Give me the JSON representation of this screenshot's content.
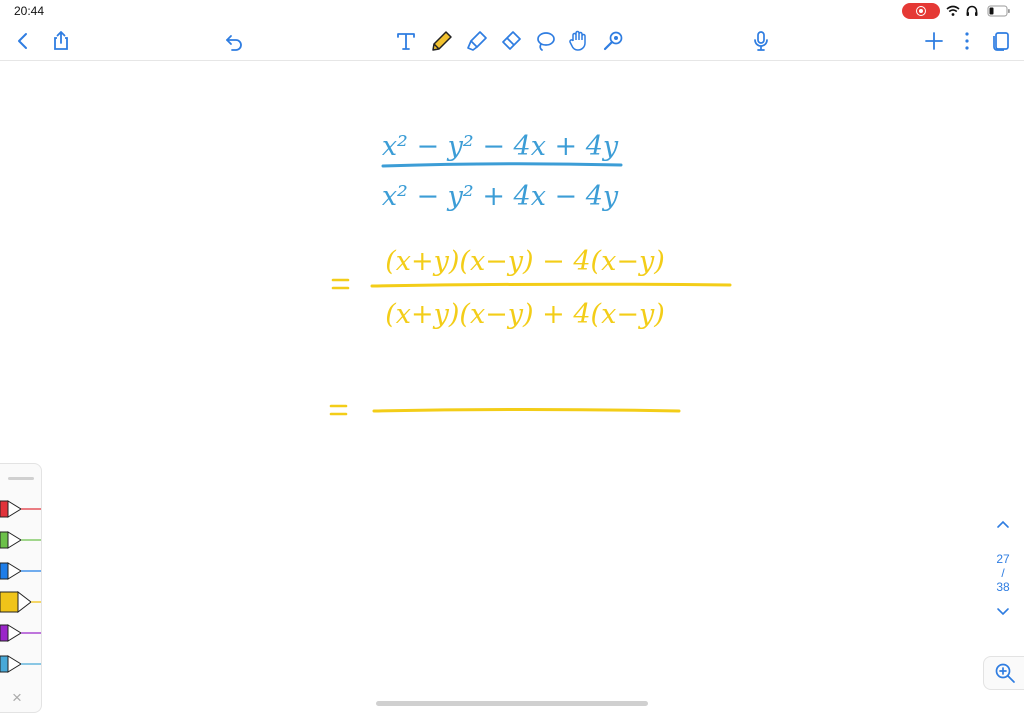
{
  "status": {
    "time": "20:44",
    "icons": [
      "screen-record-icon",
      "wifi-icon",
      "headphones-icon",
      "battery-icon"
    ]
  },
  "toolbar": {
    "left": [
      "back-icon",
      "share-icon",
      "undo-icon"
    ],
    "tools": [
      "text-tool-icon",
      "pen-tool-icon",
      "highlighter-tool-icon",
      "eraser-tool-icon",
      "lasso-tool-icon",
      "hand-tool-icon",
      "laser-pointer-icon"
    ],
    "center": [
      "microphone-icon"
    ],
    "right": [
      "add-page-icon",
      "more-icon",
      "pages-icon"
    ]
  },
  "ink_colors": {
    "blue": "#3c9dd6",
    "yellow": "#f3cd18"
  },
  "handwriting": {
    "line1_numerator": "x² − y² − 4x + 4y",
    "line1_denominator": "x² − y² + 4x − 4y",
    "line2_numerator": "(x+y)(x−y) − 4(x−y)",
    "line2_denominator": "(x+y)(x−y) + 4(x−y)"
  },
  "pen_tray": {
    "pens": [
      {
        "name": "red",
        "color": "#e0323a"
      },
      {
        "name": "green",
        "color": "#6cc04a"
      },
      {
        "name": "blue",
        "color": "#1e7de8"
      },
      {
        "name": "yellow",
        "color": "#f0c419"
      },
      {
        "name": "purple",
        "color": "#9a26c9"
      },
      {
        "name": "light-blue",
        "color": "#48a9d8"
      }
    ],
    "close_label": "×"
  },
  "pager": {
    "current": "27",
    "separator": "/",
    "total": "38"
  }
}
